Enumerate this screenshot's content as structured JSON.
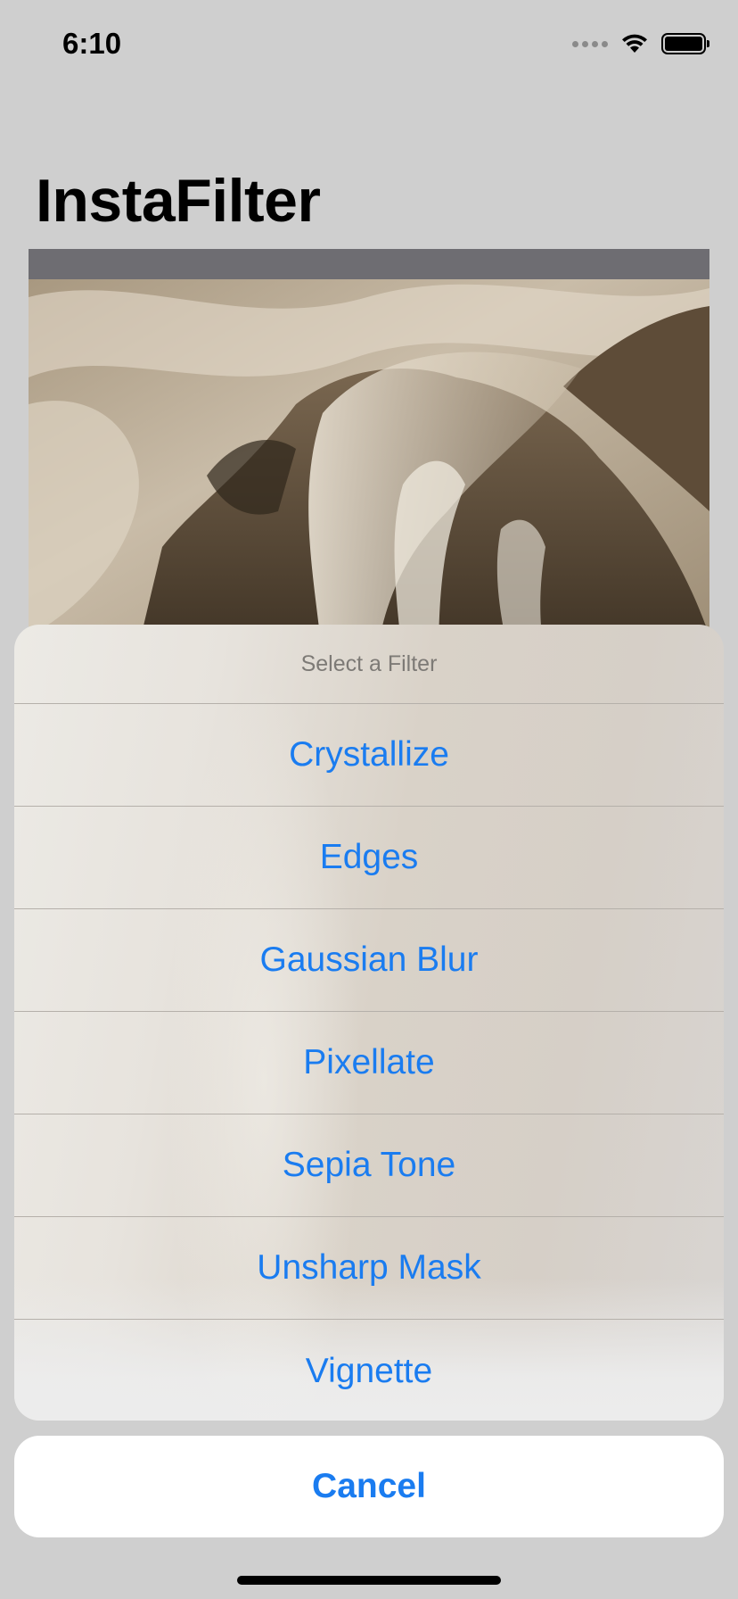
{
  "status_bar": {
    "time": "6:10",
    "icons": [
      "cellular-signal-icon",
      "wifi-icon",
      "battery-icon"
    ]
  },
  "header": {
    "title": "InstaFilter"
  },
  "image": {
    "icon": "sepia-waterfall-photo"
  },
  "action_sheet": {
    "title": "Select a Filter",
    "options": [
      "Crystallize",
      "Edges",
      "Gaussian Blur",
      "Pixellate",
      "Sepia Tone",
      "Unsharp Mask",
      "Vignette"
    ],
    "cancel_label": "Cancel"
  },
  "colors": {
    "accent": "#1a7cf0",
    "background": "#cfcfcf",
    "sheet_title": "#7d7a76"
  }
}
